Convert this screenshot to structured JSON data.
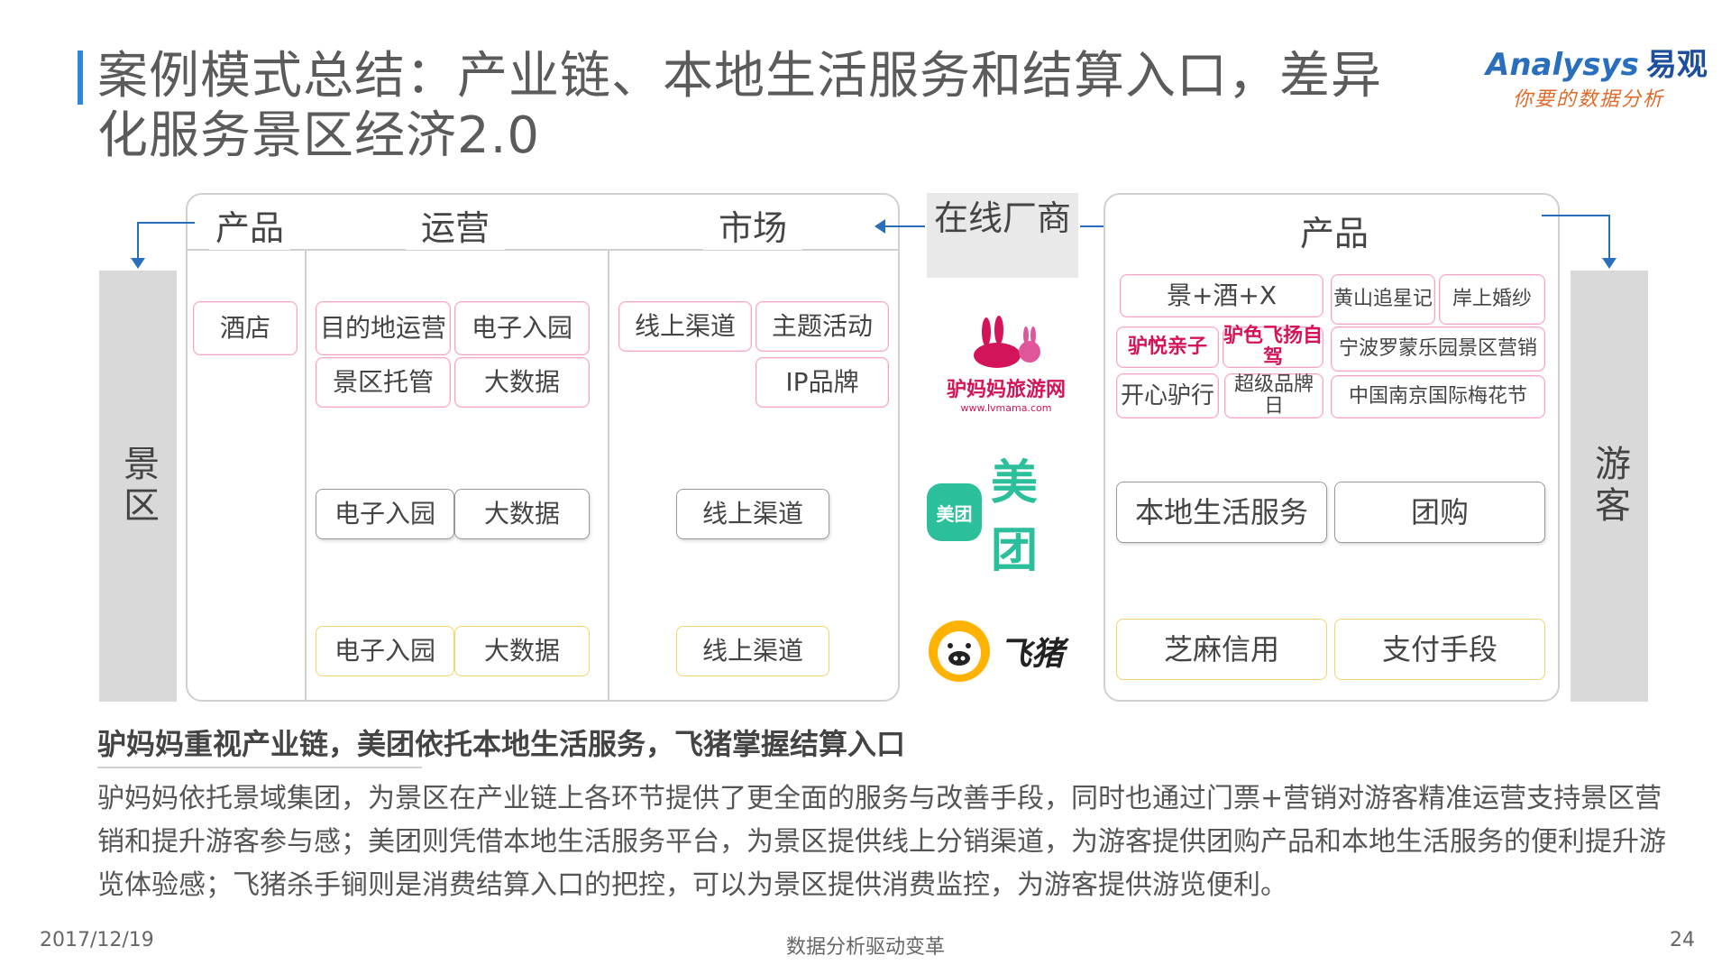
{
  "title": "案例模式总结：产业链、本地生活服务和结算入口，差异化服务景区经济2.0",
  "logo": {
    "main_latin": "Analysys",
    "main_cn": "易观",
    "tagline": "你要的数据分析"
  },
  "left_sidebar": "景区",
  "right_sidebar": "游客",
  "left_panel": {
    "headers": [
      "产品",
      "运营",
      "市场"
    ],
    "row1": {
      "product": [
        "酒店"
      ],
      "operation": [
        "目的地运营",
        "电子入园",
        "景区托管",
        "大数据"
      ],
      "market": [
        "线上渠道",
        "主题活动",
        "IP品牌"
      ]
    },
    "row2": {
      "operation": [
        "电子入园",
        "大数据"
      ],
      "market": [
        "线上渠道"
      ]
    },
    "row3": {
      "operation": [
        "电子入园",
        "大数据"
      ],
      "market": [
        "线上渠道"
      ]
    }
  },
  "center": {
    "tag": "在线厂商",
    "lvmama": {
      "name": "驴妈妈旅游网",
      "url": "www.lvmama.com"
    },
    "meituan": {
      "badge": "美团",
      "name": "美团"
    },
    "fliggy": {
      "name": "飞猪"
    }
  },
  "right_panel": {
    "header": "产品",
    "row1": {
      "items": [
        "景+酒+X",
        "黄山追星记",
        "岸上婚纱",
        "驴悦亲子",
        "驴色飞扬自驾",
        "宁波罗蒙乐园景区营销",
        "开心驴行",
        "超级品牌日",
        "中国南京国际梅花节"
      ]
    },
    "row2": [
      "本地生活服务",
      "团购"
    ],
    "row3": [
      "芝麻信用",
      "支付手段"
    ]
  },
  "subheading": "驴妈妈重视产业链，美团依托本地生活服务，飞猪掌握结算入口",
  "paragraph": "驴妈妈依托景域集团，为景区在产业链上各环节提供了更全面的服务与改善手段，同时也通过门票+营销对游客精准运营支持景区营销和提升游客参与感；美团则凭借本地生活服务平台，为景区提供线上分销渠道，为游客提供团购产品和本地生活服务的便利提升游览体验感；飞猪杀手锏则是消费结算入口的把控，可以为景区提供消费监控，为游客提供游览便利。",
  "footer": {
    "date": "2017/12/19",
    "center": "数据分析驱动变革",
    "page": "24"
  },
  "colors": {
    "accent": "#2a6fbd",
    "pink": "#f4a6c8",
    "yellow": "#f3d46a",
    "gray_box": "#9a9a9a",
    "sidebar": "#d9d9d9"
  }
}
